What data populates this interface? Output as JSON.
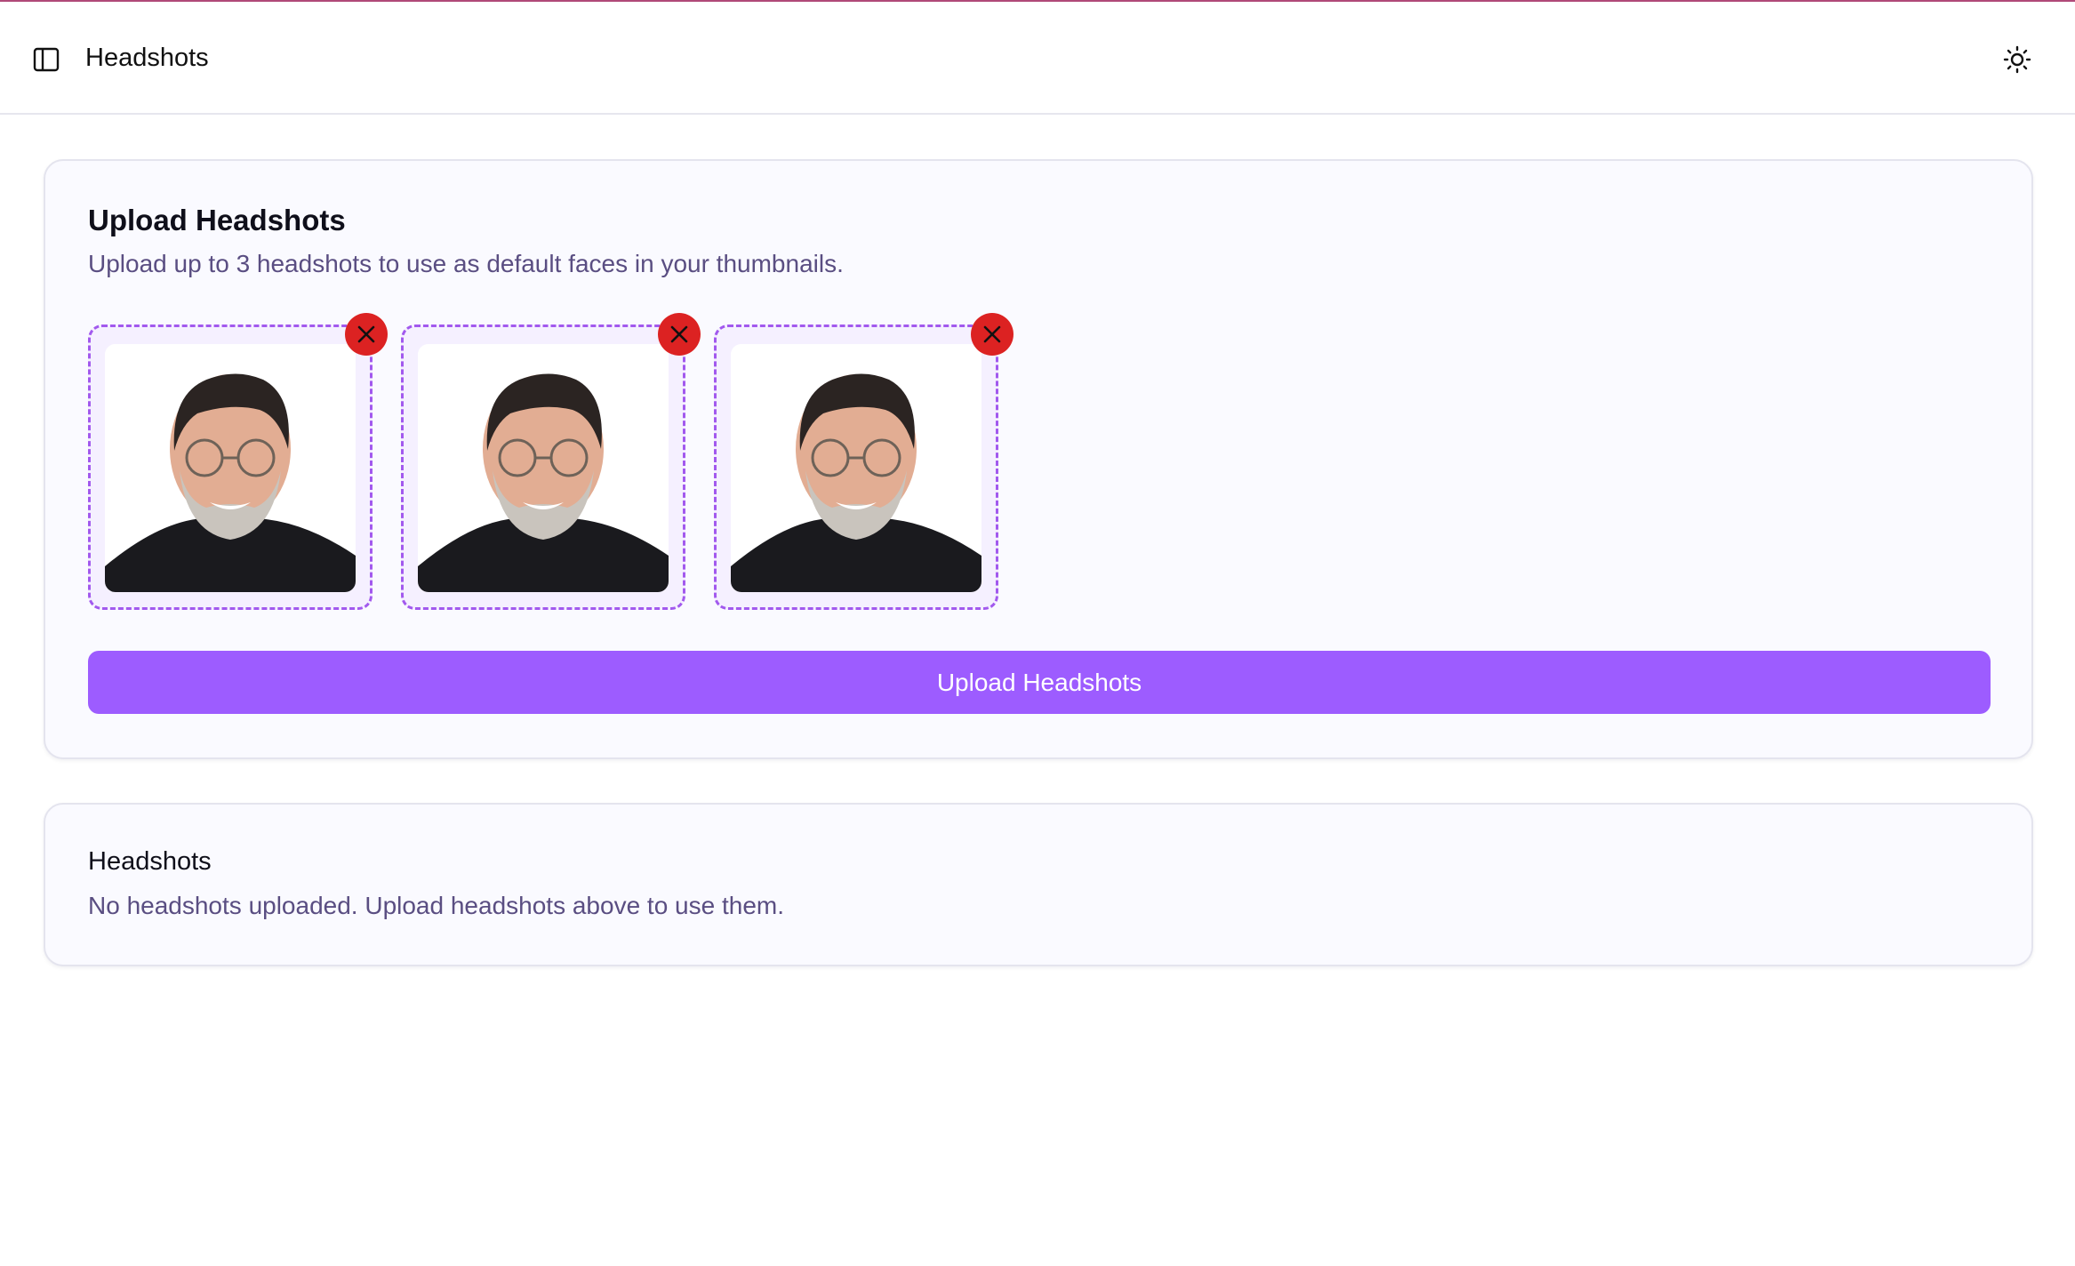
{
  "header": {
    "title": "Headshots",
    "sidebar_toggle_icon": "sidebar-panel-icon",
    "theme_toggle_icon": "sun-icon"
  },
  "upload_card": {
    "title": "Upload Headshots",
    "description": "Upload up to 3 headshots to use as default faces in your thumbnails.",
    "thumbnails": [
      {
        "remove_icon": "close-icon"
      },
      {
        "remove_icon": "close-icon"
      },
      {
        "remove_icon": "close-icon"
      }
    ],
    "upload_button_label": "Upload Headshots"
  },
  "headshots_card": {
    "title": "Headshots",
    "empty_message": "No headshots uploaded. Upload headshots above to use them."
  },
  "colors": {
    "accent": "#9d5cff",
    "thumbnail_border": "#a259ee",
    "remove": "#dc2222",
    "muted_text": "#5a4e82"
  }
}
